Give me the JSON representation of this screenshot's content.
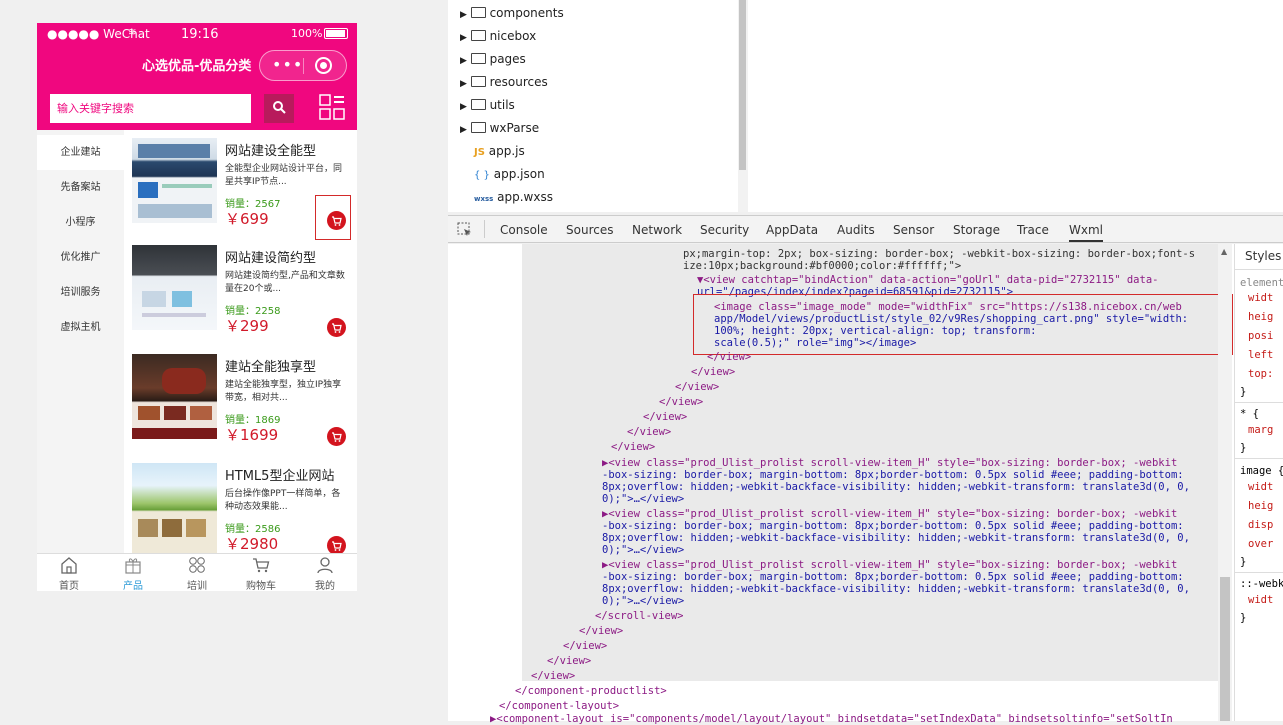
{
  "status_bar": {
    "carrier": "●●●●● WeChat",
    "time": "19:16",
    "battery": "100%"
  },
  "app": {
    "title": "心选优品-优品分类",
    "search_placeholder": "输入关键字搜索"
  },
  "sidebar": {
    "items": [
      {
        "label": "企业建站"
      },
      {
        "label": "先备案站"
      },
      {
        "label": "小程序"
      },
      {
        "label": "优化推广"
      },
      {
        "label": "培训服务"
      },
      {
        "label": "虚拟主机"
      }
    ]
  },
  "products": [
    {
      "name": "网站建设全能型",
      "desc": "全能型企业网站设计平台，同星共享IP节点...",
      "sales": "销量：2567",
      "price": "￥699"
    },
    {
      "name": "网站建设简约型",
      "desc": "网站建设简约型,产品和文章数量在20个或...",
      "sales": "销量：2258",
      "price": "￥299"
    },
    {
      "name": "建站全能独享型",
      "desc": "建站全能独享型，独立IP独享带宽，相对共...",
      "sales": "销量：1869",
      "price": "￥1699"
    },
    {
      "name": "HTML5型企业网站",
      "desc": "后台操作像PPT一样简单，各种动态效果能...",
      "sales": "销量：2586",
      "price": "￥2980"
    }
  ],
  "tabbar": [
    {
      "label": "首页",
      "icon": "home-icon"
    },
    {
      "label": "产品",
      "icon": "gift-icon"
    },
    {
      "label": "培训",
      "icon": "grid-icon"
    },
    {
      "label": "购物车",
      "icon": "cart-icon"
    },
    {
      "label": "我的",
      "icon": "user-icon"
    }
  ],
  "file_tree": [
    {
      "label": "components",
      "type": "folder"
    },
    {
      "label": "nicebox",
      "type": "folder"
    },
    {
      "label": "pages",
      "type": "folder"
    },
    {
      "label": "resources",
      "type": "folder"
    },
    {
      "label": "utils",
      "type": "folder"
    },
    {
      "label": "wxParse",
      "type": "folder"
    },
    {
      "label": "app.js",
      "type": "js",
      "badge": "JS"
    },
    {
      "label": "app.json",
      "type": "json",
      "badge": "{ }"
    },
    {
      "label": "app.wxss",
      "type": "wxss",
      "badge": "wxss"
    }
  ],
  "devtools_tabs": [
    "Console",
    "Sources",
    "Network",
    "Security",
    "AppData",
    "Audits",
    "Sensor",
    "Storage",
    "Trace",
    "Wxml"
  ],
  "styles_panel": {
    "header": "Styles",
    "lines": [
      "element",
      "widt",
      "heig",
      "posi",
      "left",
      "top:",
      "}",
      "* {",
      "marg",
      "}",
      "image {",
      "widt",
      "heig",
      "disp",
      "over",
      "}",
      "::-webk",
      "widt",
      "}"
    ]
  },
  "code_lines": [
    "px;margin-top: 2px; box-sizing: border-box; -webkit-box-sizing: border-box;font-s",
    "ize:10px;background:#bf0000;color:#ffffff;\">",
    "▼<view catchtap=\"bindAction\" data-action=\"goUrl\" data-pid=\"2732115\" data-",
    "url=\"/pages/index/index?pageid=68591&pid=2732115\">",
    "<image class=\"image_mode\" mode=\"widthFix\" src=\"https://s138.nicebox.cn/web",
    "app/Model/views/productList/style_02/v9Res/shopping_cart.png\" style=\"width:",
    "100%; height: 20px; vertical-align: top; transform:",
    "scale(0.5);\" role=\"img\"></image>",
    "</view>",
    "</view>",
    "</view>",
    "</view>",
    "</view>",
    "</view>",
    "</view>",
    "▶<view class=\"prod_Ulist_prolist scroll-view-item_H\" style=\"box-sizing: border-box; -webkit",
    "-box-sizing: border-box; margin-bottom: 8px;border-bottom: 0.5px solid #eee; padding-bottom:",
    "8px;overflow: hidden;-webkit-backface-visibility: hidden;-webkit-transform: translate3d(0, 0,",
    "0);\">…</view>",
    "</scroll-view>",
    "</view>",
    "</view>",
    "</view>",
    "</view>",
    "</component-productlist>",
    "</component-layout>",
    "▶<component-layout is=\"components/model/layout/layout\" bindsetdata=\"setIndexData\" bindsetsoltinfo=\"setSoltIn"
  ]
}
